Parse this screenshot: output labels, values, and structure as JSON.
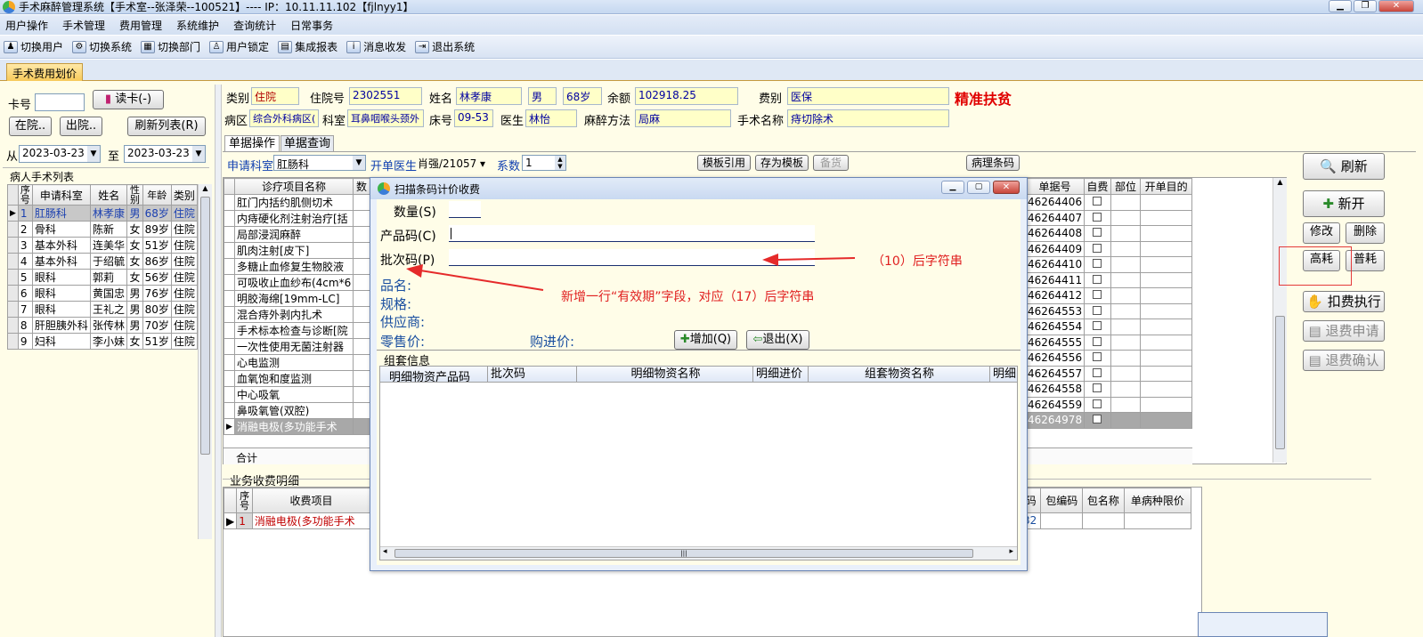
{
  "window": {
    "title": "手术麻醉管理系统【手术室--张泽荣--100521】---- IP：10.11.11.102【fjlnyy1】"
  },
  "menu": [
    "用户操作",
    "手术管理",
    "费用管理",
    "系统维护",
    "查询统计",
    "日常事务"
  ],
  "toolbar": [
    {
      "label": "切换用户",
      "icon": "users-icon"
    },
    {
      "label": "切换系统",
      "icon": "system-icon"
    },
    {
      "label": "切换部门",
      "icon": "dept-icon"
    },
    {
      "label": "用户锁定",
      "icon": "lock-icon"
    },
    {
      "label": "集成报表",
      "icon": "report-icon"
    },
    {
      "label": "消息收发",
      "icon": "info-icon"
    },
    {
      "label": "退出系统",
      "icon": "exit-icon"
    }
  ],
  "main_tab": "手术费用划价",
  "left": {
    "card_label": "卡号",
    "card_value": "",
    "read_card": "读卡(-)",
    "inhospital": "在院..",
    "discharged": "出院..",
    "refresh_list": "刷新列表(R)",
    "from_label": "从",
    "from_date": "2023-03-23",
    "to_label": "至",
    "to_date": "2023-03-23",
    "list_title": "病人手术列表",
    "columns": [
      "序号",
      "申请科室",
      "姓名",
      "性别",
      "年龄",
      "类别"
    ],
    "rows": [
      [
        "1",
        "肛肠科",
        "林孝康",
        "男",
        "68岁",
        "住院"
      ],
      [
        "2",
        "骨科",
        "陈新",
        "女",
        "89岁",
        "住院"
      ],
      [
        "3",
        "基本外科",
        "连美华",
        "女",
        "51岁",
        "住院"
      ],
      [
        "4",
        "基本外科",
        "于绍毓",
        "女",
        "86岁",
        "住院"
      ],
      [
        "5",
        "眼科",
        "郭莉",
        "女",
        "56岁",
        "住院"
      ],
      [
        "6",
        "眼科",
        "黄国忠",
        "男",
        "76岁",
        "住院"
      ],
      [
        "7",
        "眼科",
        "王礼之",
        "男",
        "80岁",
        "住院"
      ],
      [
        "8",
        "肝胆胰外科",
        "张传林",
        "男",
        "70岁",
        "住院"
      ],
      [
        "9",
        "妇科",
        "李小妹",
        "女",
        "51岁",
        "住院"
      ]
    ]
  },
  "patient": {
    "type_label": "类别",
    "type": "住院",
    "inno_label": "住院号",
    "inno": "2302551",
    "name_label": "姓名",
    "name": "林孝康",
    "sex": "男",
    "age": "68岁",
    "balance_label": "余额",
    "balance": "102918.25",
    "fee_label": "费别",
    "fee": "医保",
    "poverty": "精准扶贫",
    "ward_label": "病区",
    "ward": "综合外科病区(",
    "dept_label": "科室",
    "dept": "耳鼻咽喉头颈外",
    "bed_label": "床号",
    "bed": "09-53",
    "doctor_label": "医生",
    "doctor": "林怡",
    "anes_label": "麻醉方法",
    "anes": "局麻",
    "op_label": "手术名称",
    "op": "痔切除术"
  },
  "subtabs": [
    "单据操作",
    "单据查询"
  ],
  "filters": {
    "apply_dept_label": "申请科室",
    "apply_dept": "肛肠科",
    "doctor_label": "开单医生",
    "doctor": "肖强/21057",
    "coef_label": "系数",
    "coef": "1",
    "template_ref": "模板引用",
    "save_template": "存为模板",
    "stock": "备货",
    "pathology": "病理条码"
  },
  "items_table": {
    "columns": [
      "诊疗项目名称",
      "数"
    ],
    "rows": [
      "肛门内括约肌侧切术",
      "内痔硬化剂注射治疗[括",
      "局部浸润麻醉",
      "肌肉注射[皮下]",
      "多糖止血修复生物胶液",
      "可吸收止血纱布(4cm*6",
      "明胶海绵[19mm-LC]",
      "混合痔外剥内扎术",
      "手术标本检查与诊断[院",
      "一次性使用无菌注射器",
      "心电监测",
      "血氧饱和度监测",
      "中心吸氧",
      "鼻吸氧管(双腔)",
      "消融电极(多功能手术"
    ],
    "total_label": "合计"
  },
  "right_table": {
    "columns": [
      "单据号",
      "自费",
      "部位",
      "开单目的"
    ],
    "rows": [
      "46264406",
      "46264407",
      "46264408",
      "46264409",
      "46264410",
      "46264411",
      "46264412",
      "46264553",
      "46264554",
      "46264555",
      "46264556",
      "46264557",
      "46264558",
      "46264559",
      "46264978"
    ]
  },
  "right_buttons": {
    "refresh": "刷新",
    "new": "新开",
    "modify": "修改",
    "delete": "删除",
    "high": "高耗",
    "normal": "普耗",
    "execute": "扣费执行",
    "refund_apply": "退费申请",
    "refund_confirm": "退费确认"
  },
  "biz": {
    "title": "业务收费明细",
    "columns": [
      "序号",
      "收费项目"
    ],
    "row": [
      "1",
      "消融电极(多功能手术"
    ],
    "right_columns": [
      "码",
      "包编码",
      "包名称",
      "单病种限价"
    ],
    "right_code": "32"
  },
  "dialog": {
    "title": "扫描条码计价收费",
    "qty_label": "数量(S)",
    "product_label": "产品码(C)",
    "batch_label": "批次码(P)",
    "name_label": "品名:",
    "spec_label": "规格:",
    "supplier_label": "供应商:",
    "retail_label": "零售价:",
    "purchase_label": "购进价:",
    "add_btn": "增加(Q)",
    "exit_btn": "退出(X)",
    "group_title": "组套信息",
    "group_columns": [
      "明细物资产品码",
      "批次码",
      "明细物资名称",
      "明细进价",
      "组套物资名称",
      "明细"
    ]
  },
  "annotations": {
    "batch_note": "（10）后字符串",
    "expiry_note": "新增一行“有效期”字段，对应（17）后字符串"
  }
}
